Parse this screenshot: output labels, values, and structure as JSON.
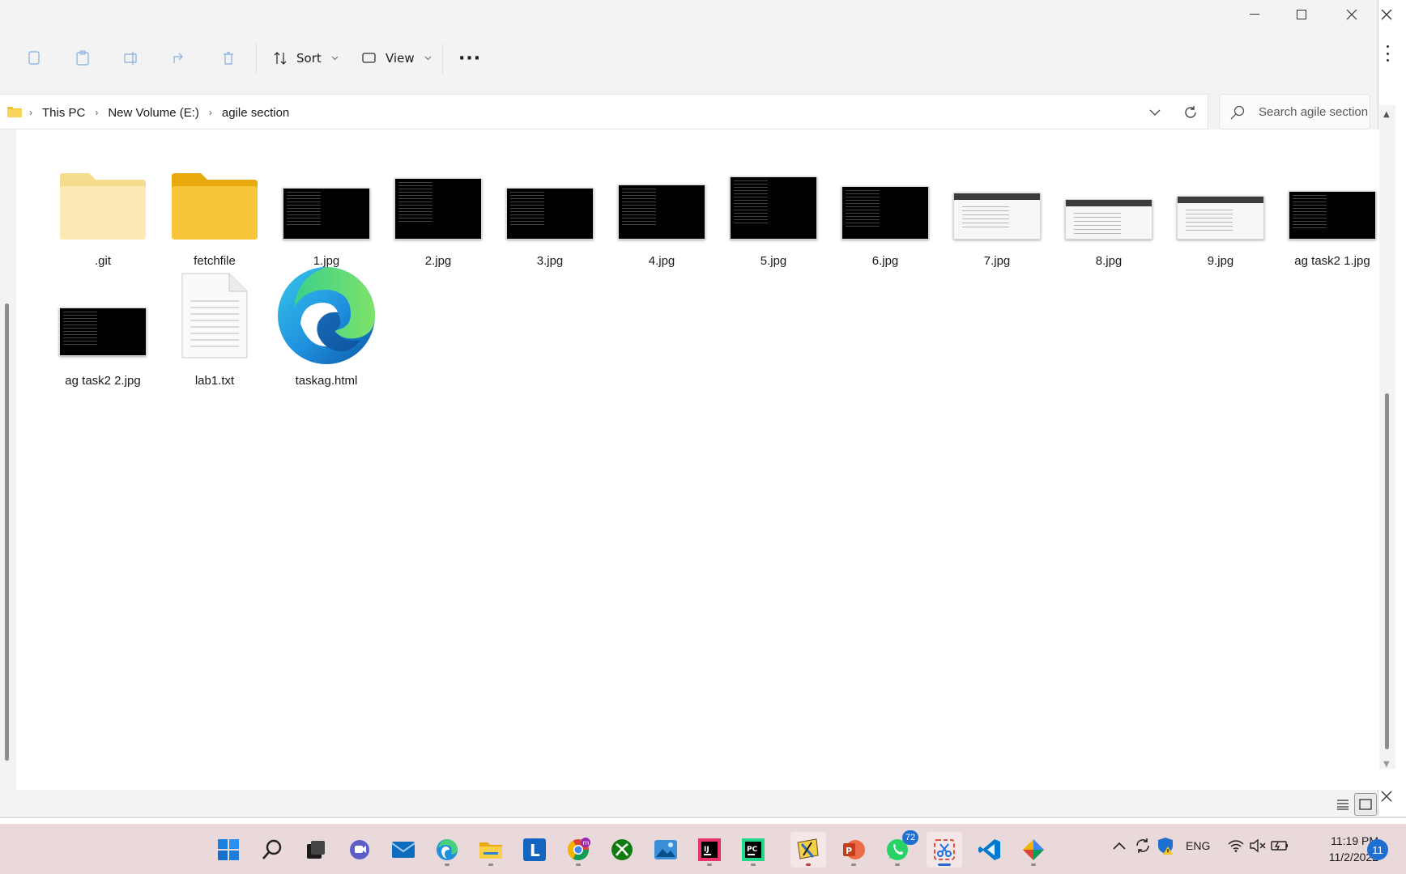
{
  "toolbar": {
    "sort_label": "Sort",
    "view_label": "View",
    "more_label": "···"
  },
  "breadcrumb": [
    "This PC",
    "New Volume (E:)",
    "agile section"
  ],
  "search": {
    "placeholder": "Search agile section"
  },
  "items": [
    {
      "name": ".git",
      "kind": "folder-light"
    },
    {
      "name": "fetchfile",
      "kind": "folder"
    },
    {
      "name": "1.jpg",
      "kind": "image-dark"
    },
    {
      "name": "2.jpg",
      "kind": "image-dark"
    },
    {
      "name": "3.jpg",
      "kind": "image-dark"
    },
    {
      "name": "4.jpg",
      "kind": "image-dark"
    },
    {
      "name": "5.jpg",
      "kind": "image-dark"
    },
    {
      "name": "6.jpg",
      "kind": "image-dark"
    },
    {
      "name": "7.jpg",
      "kind": "image-light"
    },
    {
      "name": "8.jpg",
      "kind": "image-light"
    },
    {
      "name": "9.jpg",
      "kind": "image-light"
    },
    {
      "name": "ag task2 1.jpg",
      "kind": "image-dark"
    },
    {
      "name": "ag task2 2.jpg",
      "kind": "image-dark"
    },
    {
      "name": "lab1.txt",
      "kind": "text"
    },
    {
      "name": "taskag.html",
      "kind": "edge-html"
    }
  ],
  "taskbar": {
    "apps": [
      "start-icon",
      "search-icon",
      "task-view-icon",
      "teams-chat-icon",
      "mail-icon",
      "edge-icon",
      "file-explorer-icon",
      "app-l-icon",
      "chrome-icon",
      "xbox-icon",
      "photos-icon",
      "intellij-icon",
      "pycharm-icon",
      "snip-paint-icon",
      "powerpoint-icon",
      "whatsapp-icon",
      "snipping-tool-icon",
      "vscode-icon",
      "gem-app-icon"
    ],
    "whatsapp_badge": "72",
    "language": "ENG",
    "time": "11:19 PM",
    "date": "11/2/2022",
    "notifications": "11"
  }
}
